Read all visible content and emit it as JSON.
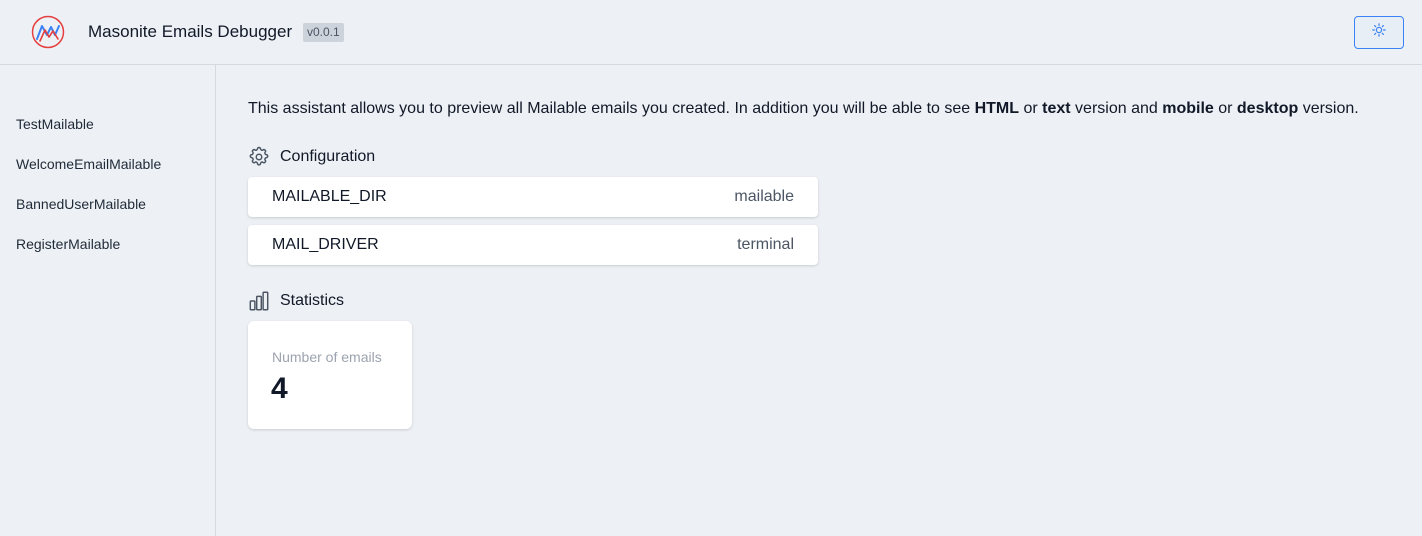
{
  "header": {
    "app_title": "Masonite Emails Debugger",
    "version": "v0.0.1",
    "logo_icon": "masonite-logo",
    "theme_toggle_icon": "sun-icon",
    "accent_color": "#3b82f6",
    "logo_color": "#e53e3e"
  },
  "sidebar": {
    "items": [
      {
        "label": "TestMailable"
      },
      {
        "label": "WelcomeEmailMailable"
      },
      {
        "label": "BannedUserMailable"
      },
      {
        "label": "RegisterMailable"
      }
    ]
  },
  "main": {
    "intro": {
      "p1": "This assistant allows you to preview all Mailable emails you created. In addition you will be able to see ",
      "b1": "HTML",
      "p2": " or ",
      "b2": "text",
      "p3": " version and ",
      "b3": "mobile",
      "p4": " or ",
      "b4": "desktop",
      "p5": " version."
    },
    "configuration": {
      "title": "Configuration",
      "icon": "gear-icon",
      "rows": [
        {
          "key": "MAILABLE_DIR",
          "value": "mailable"
        },
        {
          "key": "MAIL_DRIVER",
          "value": "terminal"
        }
      ]
    },
    "statistics": {
      "title": "Statistics",
      "icon": "bar-chart-icon",
      "cards": [
        {
          "label": "Number of emails",
          "value": "4"
        }
      ]
    }
  }
}
